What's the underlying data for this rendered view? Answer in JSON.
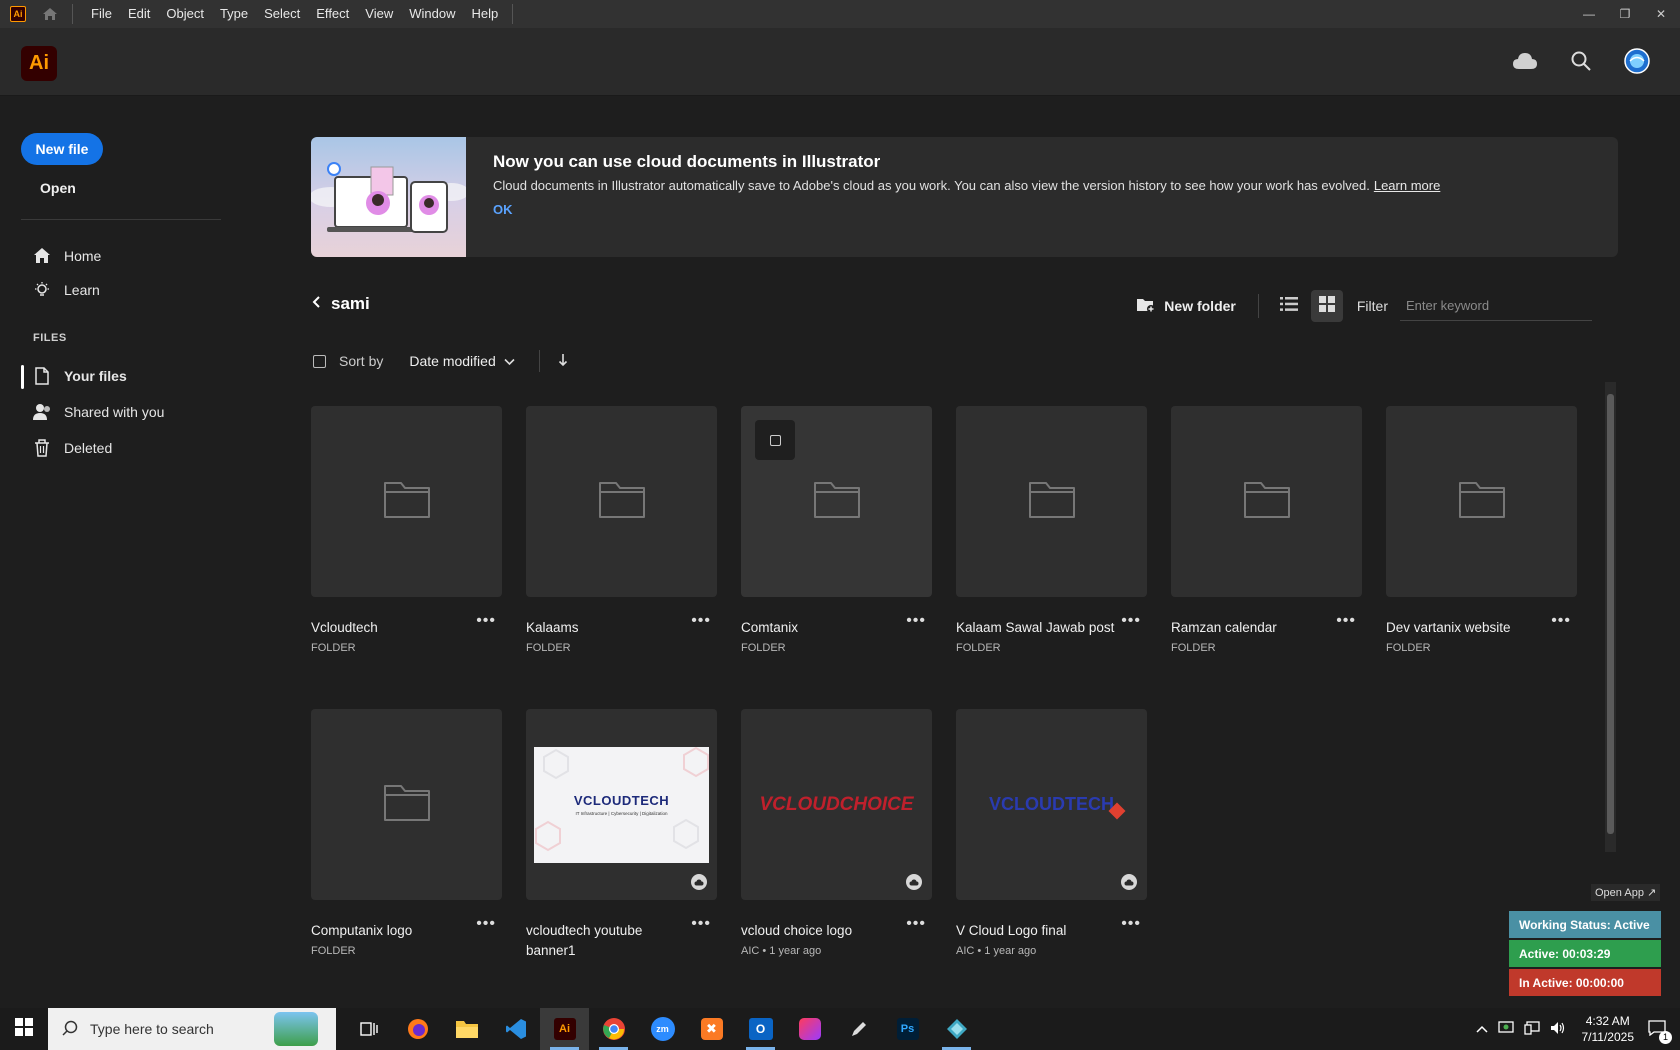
{
  "menubar": {
    "items": [
      "File",
      "Edit",
      "Object",
      "Type",
      "Select",
      "Effect",
      "View",
      "Window",
      "Help"
    ],
    "app_badge": "Ai"
  },
  "header": {
    "logo": "Ai"
  },
  "sidebar": {
    "new_file": "New file",
    "open": "Open",
    "home": "Home",
    "learn": "Learn",
    "files_label": "FILES",
    "your_files": "Your files",
    "shared": "Shared with you",
    "deleted": "Deleted"
  },
  "banner": {
    "title": "Now you can use cloud documents in Illustrator",
    "text": "Cloud documents in Illustrator automatically save to Adobe's cloud as you work. You can also view the version history to see how your work has evolved.",
    "learn_more": "Learn more",
    "ok": "OK"
  },
  "folder": {
    "name": "sami",
    "new_folder": "New folder",
    "filter_label": "Filter",
    "filter_placeholder": "Enter keyword",
    "sort_by": "Sort by",
    "sort_value": "Date modified"
  },
  "items": [
    {
      "name": "Vcloudtech",
      "sub": "FOLDER"
    },
    {
      "name": "Kalaams",
      "sub": "FOLDER"
    },
    {
      "name": "Comtanix",
      "sub": "FOLDER"
    },
    {
      "name": "Kalaam Sawal Jawab post",
      "sub": "FOLDER"
    },
    {
      "name": "Ramzan calendar",
      "sub": "FOLDER"
    },
    {
      "name": "Dev vartanix website",
      "sub": "FOLDER"
    },
    {
      "name": "Computanix logo",
      "sub": "FOLDER"
    },
    {
      "name": "vcloudtech youtube banner1",
      "sub": ""
    },
    {
      "name": "vcloud choice logo",
      "sub": "AIC • 1 year ago"
    },
    {
      "name": "V Cloud Logo final",
      "sub": "AIC • 1 year ago"
    }
  ],
  "thumbs": {
    "banner_logo": "VCLOUDTECH",
    "banner_tagline": "IT Infrastructure | Cybersecurity | Digitalization",
    "choice_logo": "VCLOUDCHOICE",
    "final_logo": "VCLOUDTECH"
  },
  "widget": {
    "open_app": "Open App ↗",
    "working_status": "Working Status: Active",
    "active": "Active: 00:03:29",
    "inactive": "In Active: 00:00:00"
  },
  "taskbar": {
    "search_placeholder": "Type here to search",
    "time": "4:32 AM",
    "date": "7/11/2025",
    "notif_count": "1"
  },
  "colors": {
    "accent": "#1473e6",
    "ai_orange": "#ff9a00",
    "status_blue": "#4a90a4",
    "status_green": "#2e9e4e",
    "status_red": "#c0392b"
  }
}
